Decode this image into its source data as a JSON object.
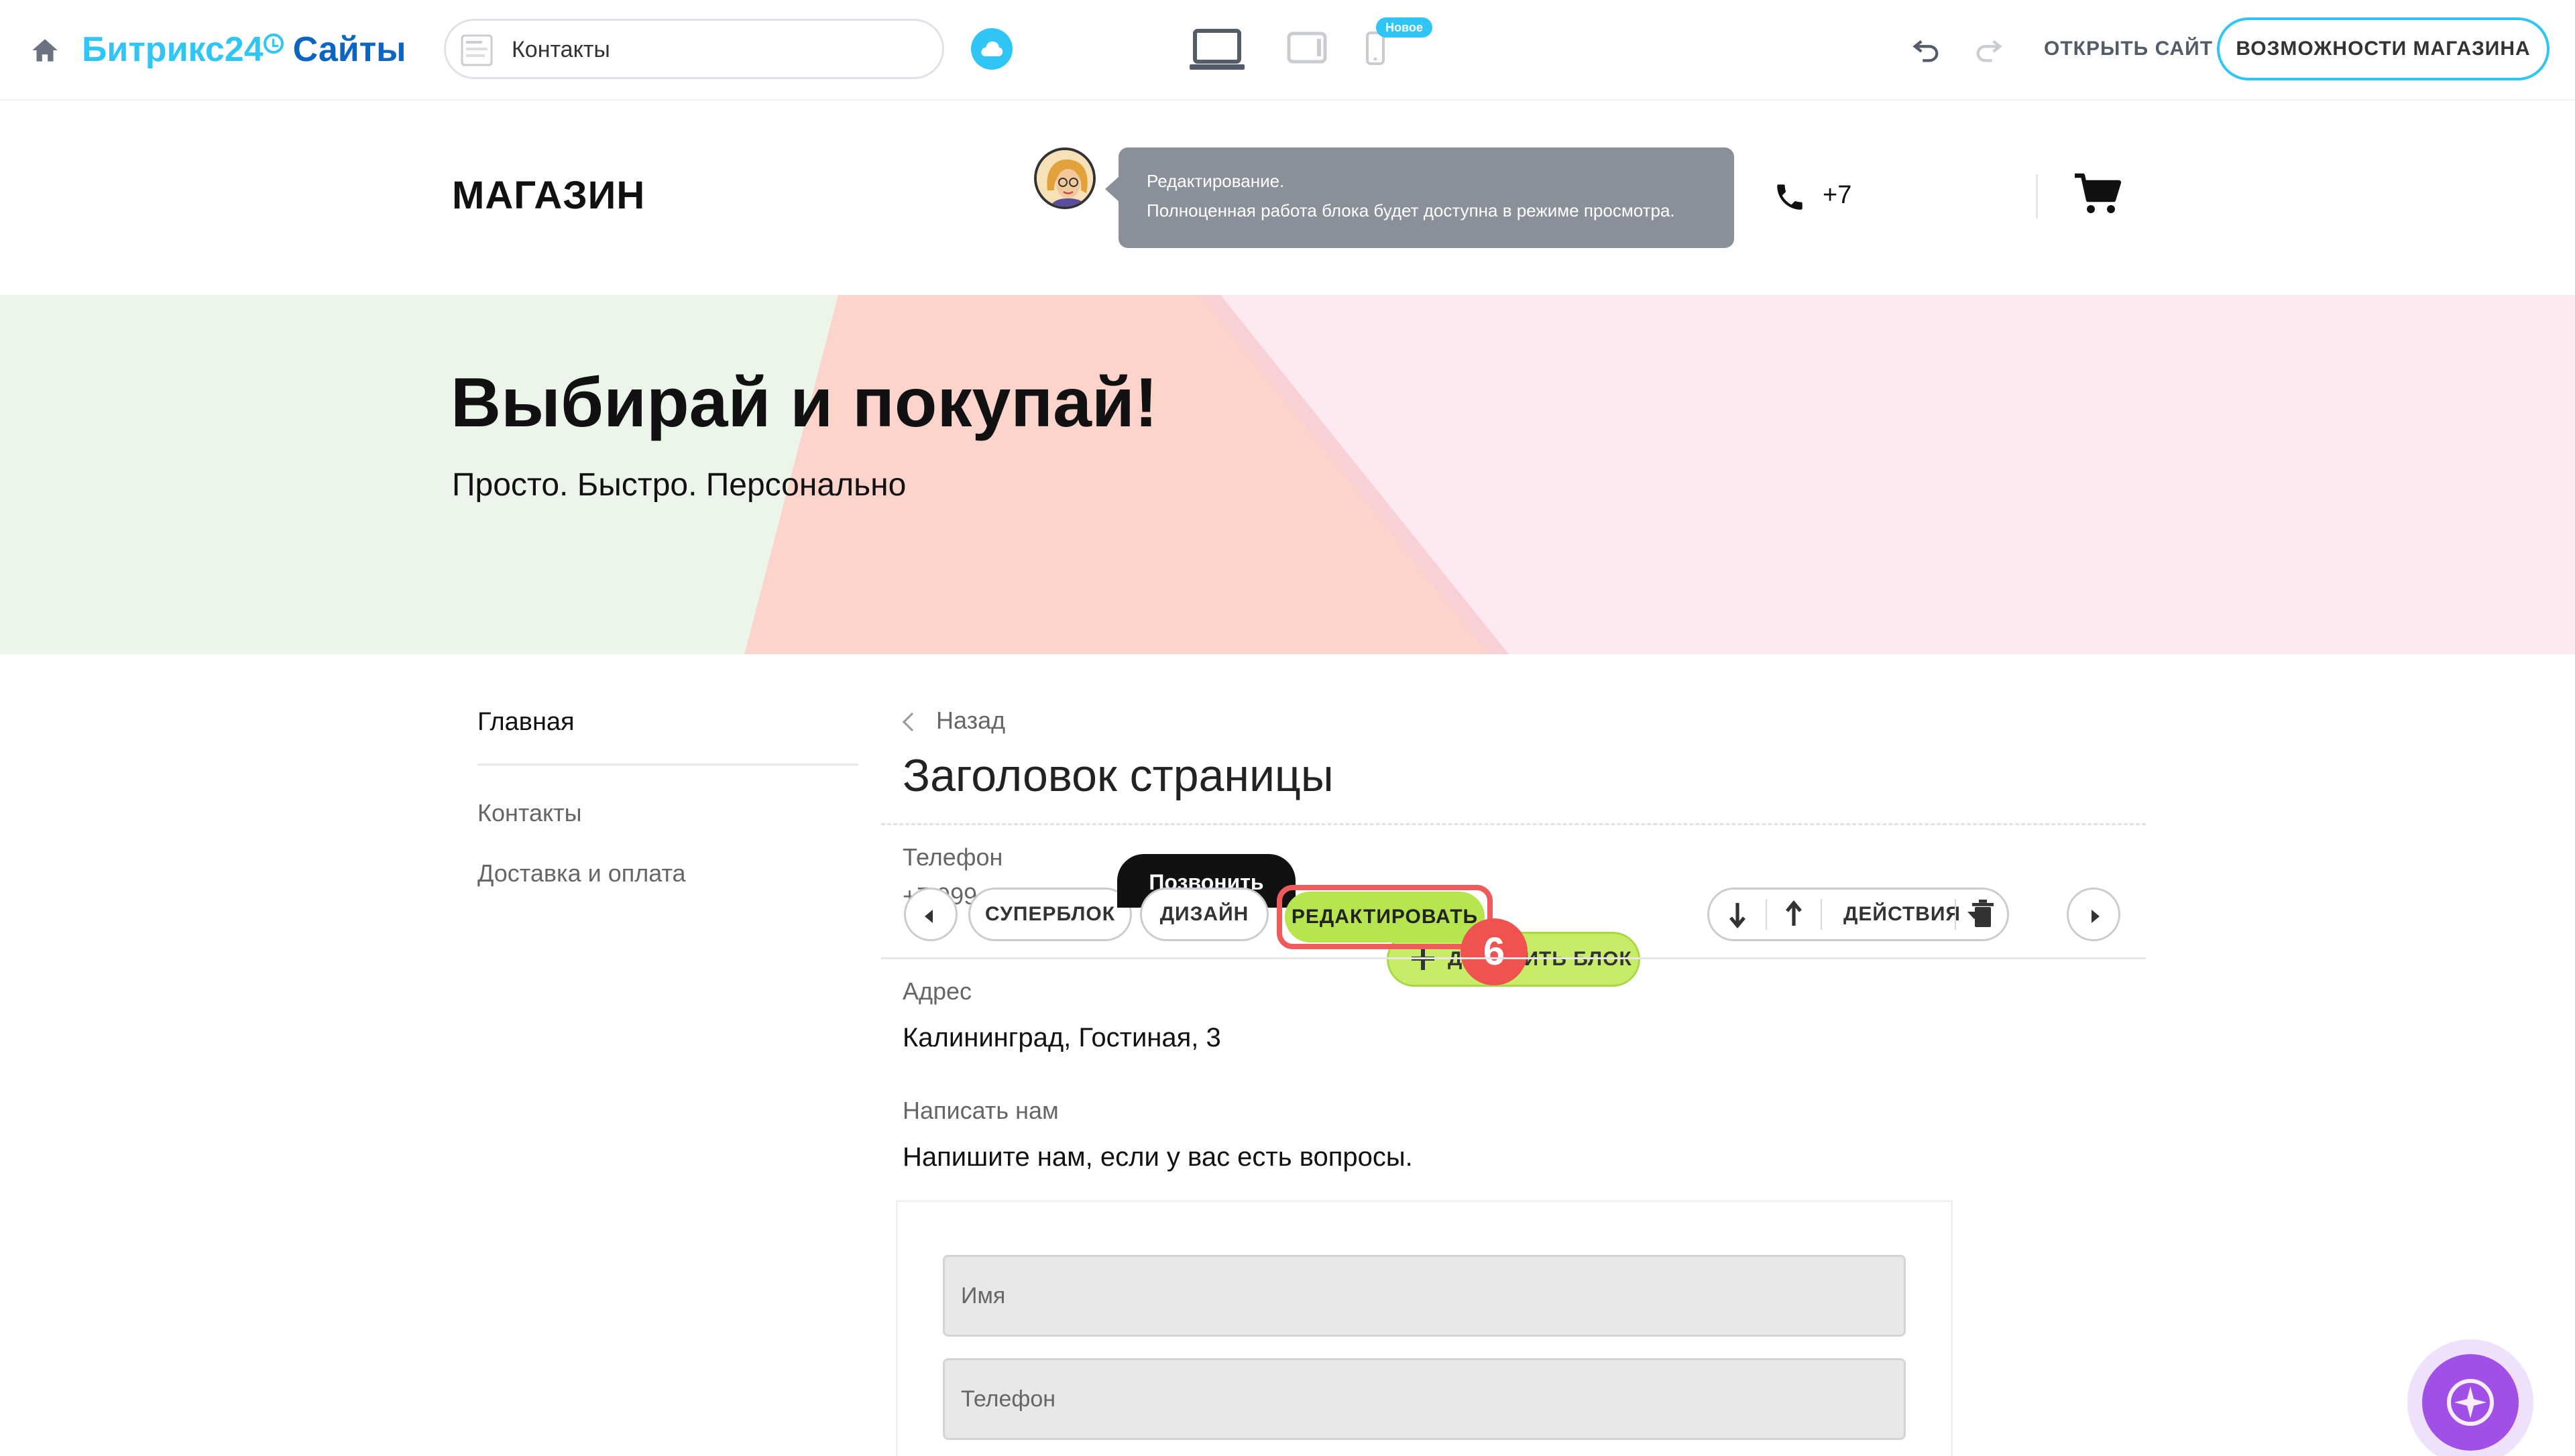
{
  "topbar": {
    "logo_brand": "Битрикс24",
    "logo_product": "Сайты",
    "page_select": "Контакты",
    "new_badge": "Новое",
    "open_site": "ОТКРЫТЬ САЙТ",
    "store_features": "ВОЗМОЖНОСТИ МАГАЗИНА",
    "accent_color": "#2fc6f6"
  },
  "header": {
    "shop_name": "МАГАЗИН",
    "tooltip_line1": "Редактирование.",
    "tooltip_line2": "Полноценная работа блока будет доступна в режиме просмотра.",
    "phone": "+7"
  },
  "hero": {
    "title": "Выбирай и покупай!",
    "subtitle": "Просто. Быстро. Персонально"
  },
  "sidebar": {
    "items": [
      {
        "label": "Главная"
      },
      {
        "label": "Контакты"
      },
      {
        "label": "Доставка и оплата"
      }
    ]
  },
  "main": {
    "back": "Назад",
    "page_title": "Заголовок страницы",
    "phone_label": "Телефон",
    "phone_value": "+7 999",
    "address_label": "Адрес",
    "address_value": "Калининград, Гостиная, 3",
    "write_label": "Написать нам",
    "write_value": "Напишите нам, если у вас есть вопросы."
  },
  "block_toolbar": {
    "superblock": "СУПЕРБЛОК",
    "design": "ДИЗАЙН",
    "edit": "РЕДАКТИРОВАТЬ",
    "add_block": "ДОБАВИТЬ БЛОК",
    "call_tooltip": "Позвонить",
    "actions": "ДЕЙСТВИЯ",
    "step_number": "6",
    "highlight_color": "#f05a5a",
    "edit_color": "#b6e550"
  },
  "form": {
    "name_placeholder": "Имя",
    "phone_placeholder": "Телефон"
  }
}
